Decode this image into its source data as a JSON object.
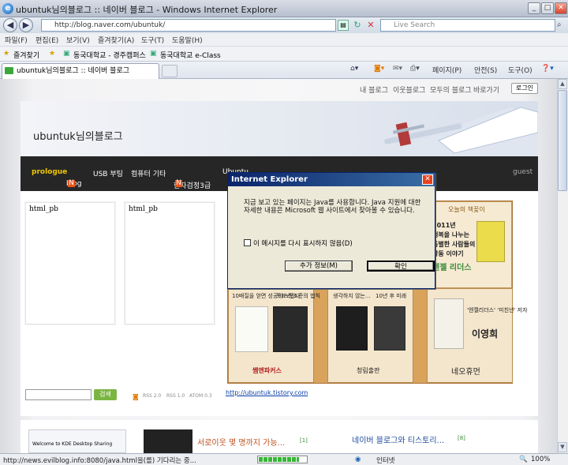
{
  "window": {
    "title": "ubuntuk님의블로그 :: 네이버 블로그 - Windows Internet Explorer"
  },
  "address": {
    "url": "http://blog.naver.com/ubuntuk/",
    "search_placeholder": "Live Search"
  },
  "menu": [
    "파일(F)",
    "편집(E)",
    "보기(V)",
    "즐겨찾기(A)",
    "도구(T)",
    "도움말(H)"
  ],
  "favorites": {
    "label": "즐겨찾기",
    "items": [
      "동국대학교 - 경주캠퍼스",
      "동국대학교 e-Class"
    ]
  },
  "tab": {
    "title": "ubuntuk님의블로그 :: 네이버 블로그"
  },
  "commands": [
    "페이지(P)",
    "안전(S)",
    "도구(O)"
  ],
  "blog": {
    "top_links": [
      "내 블로그",
      "이웃블로그",
      "모두의 블로그",
      "바로가기"
    ],
    "login": "로그인",
    "title": "ubuntuk님의블로그",
    "nav": [
      "prologue",
      "blog",
      "USB 부팅",
      "컴퓨터 기타",
      "한자검정3급",
      "Ubuntu"
    ],
    "guest": "guest",
    "pb1": "html_pb",
    "pb2": "html_pb",
    "search_btn": "검색",
    "rss": [
      "RSS 2.0",
      "RSS 1.0",
      "ATOM 0.3"
    ],
    "link": "http://ubuntuk.tistory.com"
  },
  "shelf": {
    "header": "오늘의 책꽂이",
    "promo": [
      "2011년",
      "행복을 나누는",
      "특별한 사람들의",
      "감동 이야기",
      "엔젤 리더스"
    ],
    "captions": [
      "10배질을 얻면 성공이 보인다",
      "목표 정조준의 법칙",
      "생각하지 않는...",
      "10년 후 미래",
      "'엔젤리더스' '미친년' 저자",
      "이영희"
    ],
    "publishers": [
      "쌤앤파커스",
      "청림출판",
      "네오휴먼"
    ]
  },
  "lower": {
    "thumb": "Welcome to KDE Desktop Sharing",
    "post1": "서로이웃 몇 명까지 가능...",
    "post1_count": "[1]",
    "post2": "네이버 블로그와 티스토리...",
    "post2_count": "[8]"
  },
  "dialog": {
    "title": "Internet Explorer",
    "message": "지금 보고 있는 페이지는 Java를 사용합니다. Java 지원에 대한 자세한 내용은 Microsoft 웹 사이트에서 찾아볼 수 있습니다.",
    "checkbox": "이 메시지를 다시 표시하지 않음(D)",
    "more_btn": "추가 정보(M)",
    "ok_btn": "확인"
  },
  "status": {
    "text": "http://news.evilblog.info:8080/java.html을(를) 기다리는 중...",
    "zone": "인터넷",
    "zoom": "100%",
    "progress": 0.85
  }
}
